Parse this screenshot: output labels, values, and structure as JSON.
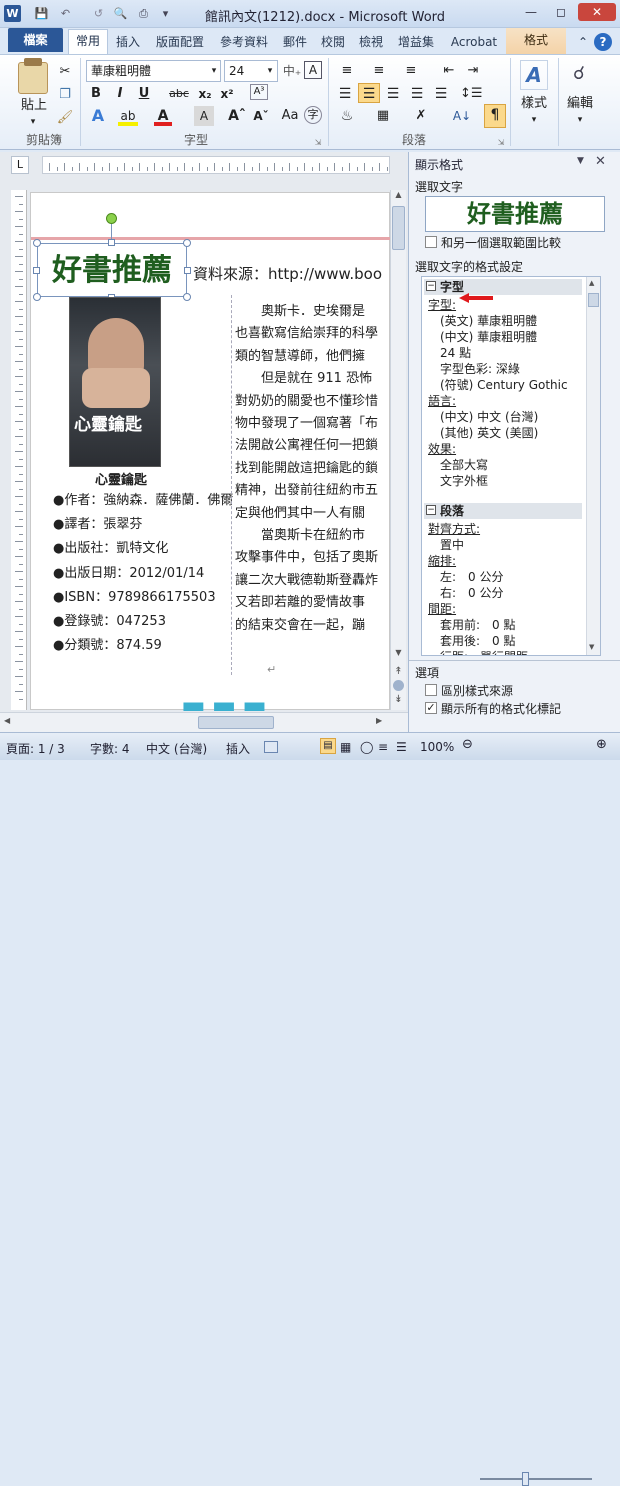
{
  "window": {
    "title": "館訊內文(1212).docx - Microsoft Word"
  },
  "tabs": {
    "file": "檔案",
    "home": "常用",
    "insert": "插入",
    "layout": "版面配置",
    "references": "參考資料",
    "mailings": "郵件",
    "review": "校閱",
    "view": "檢視",
    "addins": "增益集",
    "acrobat": "Acrobat",
    "format": "格式"
  },
  "ribbon": {
    "clipboard_label": "剪貼簿",
    "paste": "貼上",
    "font_label": "字型",
    "font_name": "華康粗明體",
    "font_size": "24",
    "paragraph_label": "段落",
    "styles": "樣式",
    "edit": "編輯"
  },
  "document": {
    "heading": "好書推薦",
    "source": "資料來源：http://www.boo",
    "book_title_cover": "心靈鑰匙",
    "book_title": "心靈鑰匙",
    "info": [
      "●作者：強納森．薩佛蘭．佛爾",
      "●譯者：張翠芬",
      "●出版社：凱特文化",
      "●出版日期：2012/01/14",
      "●ISBN：9789866175503",
      "●登錄號：047253",
      "●分類號：874.59"
    ],
    "body": [
      "　　奧斯卡．史埃爾是",
      "也喜歡寫信給崇拜的科學",
      "類的智慧導師，他們擁",
      "　　但是就在 911 恐怖",
      "對奶奶的關愛也不懂珍惜",
      "物中發現了一個寫著「布",
      "法開啟公寓裡任何一把鎖",
      "找到能開啟這把鑰匙的鎖",
      "精神，出發前往紐約市五",
      "定與他們其中一人有關",
      "　　當奧斯卡在紐約市",
      "攻擊事件中，包括了奧斯",
      "讓二次大戰德勒斯登轟炸",
      "又若即若離的愛情故事",
      "的結束交會在一起，蹦"
    ]
  },
  "panel": {
    "title": "顯示格式",
    "selected_text_label": "選取文字",
    "preview": "好書推薦",
    "compare_label": "和另一個選取範圍比較",
    "format_label": "選取文字的格式設定",
    "font_section": "字型",
    "font_link": "字型:",
    "font_items": [
      "(英文) 華康粗明體",
      "(中文) 華康粗明體",
      "24 點",
      "字型色彩: 深綠",
      "(符號) Century Gothic"
    ],
    "lang_link": "語言:",
    "lang_items": [
      "(中文) 中文 (台灣)",
      "(其他) 英文 (美國)"
    ],
    "effect_link": "效果:",
    "effect_items": [
      "全部大寫",
      "文字外框"
    ],
    "para_section": "段落",
    "align_link": "對齊方式:",
    "align_items": [
      "置中"
    ],
    "indent_link": "縮排:",
    "indent_items": [
      "左:　0 公分",
      "右:　0 公分"
    ],
    "spacing_link": "間距:",
    "spacing_items": [
      "套用前:　0 點",
      "套用後:　0 點",
      "行距:　單行間距"
    ],
    "options_label": "選項",
    "distinguish_label": "區別樣式來源",
    "show_marks_label": "顯示所有的格式化標記"
  },
  "status": {
    "page": "頁面: 1 / 3",
    "words": "字數: 4",
    "lang": "中文 (台灣)",
    "mode": "插入",
    "zoom": "100%"
  },
  "colors": {
    "accent": "#2b5797",
    "heading_green": "#1f5e1f",
    "link": "#0645ad",
    "arrow": "#e0191c"
  }
}
